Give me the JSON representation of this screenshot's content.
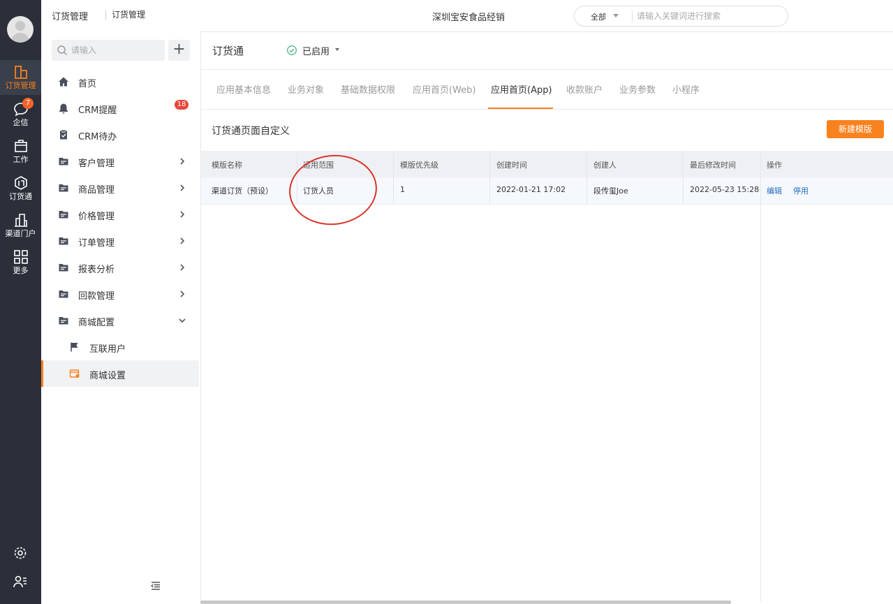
{
  "breadcrumb": {
    "module": "订货管理",
    "page": "订货管理"
  },
  "header": {
    "company": "深圳宝安食品经销",
    "search_scope": "全部",
    "search_placeholder": "请输入关键词进行搜索"
  },
  "rail": {
    "items": [
      {
        "label": "订货管理",
        "icon": "building-icon",
        "active": true
      },
      {
        "label": "企信",
        "icon": "chat-bubble-icon",
        "badge": "7"
      },
      {
        "label": "工作",
        "icon": "briefcase-icon"
      },
      {
        "label": "订货通",
        "icon": "order-app-icon"
      },
      {
        "label": "渠道门户",
        "icon": "city-icon"
      },
      {
        "label": "更多",
        "icon": "grid-icon"
      }
    ],
    "bottom": [
      "settings-icon",
      "user-list-icon"
    ]
  },
  "sidebar": {
    "search_placeholder": "请输入",
    "add_label": "+",
    "items": [
      {
        "label": "首页",
        "icon": "home-icon"
      },
      {
        "label": "CRM提醒",
        "icon": "bell-icon",
        "badge": "18"
      },
      {
        "label": "CRM待办",
        "icon": "clipboard-check-icon"
      },
      {
        "label": "客户管理",
        "icon": "folder-icon"
      },
      {
        "label": "商品管理",
        "icon": "folder-icon"
      },
      {
        "label": "价格管理",
        "icon": "folder-icon"
      },
      {
        "label": "订单管理",
        "icon": "folder-icon"
      },
      {
        "label": "报表分析",
        "icon": "folder-icon"
      },
      {
        "label": "回款管理",
        "icon": "folder-icon"
      },
      {
        "label": "商城配置",
        "icon": "folder-icon",
        "expanded": true
      }
    ],
    "sub_items": [
      {
        "label": "互联用户",
        "icon": "flag-icon"
      },
      {
        "label": "商城设置",
        "icon": "shop-settings-icon",
        "active": true
      }
    ]
  },
  "app": {
    "title": "订货通",
    "status": "已启用"
  },
  "tabs": [
    "应用基本信息",
    "业务对象",
    "基础数据权限",
    "应用首页(Web)",
    "应用首页(App)",
    "收款账户",
    "业务参数",
    "小程序"
  ],
  "active_tab": "应用首页(App)",
  "section": {
    "title": "订货通页面自定义",
    "new_button": "新建模版"
  },
  "table": {
    "headers": [
      "模版名称",
      "适用范围",
      "模版优先级",
      "创建时间",
      "创建人",
      "最后修改时间",
      "操作"
    ],
    "rows": [
      {
        "name": "渠道订货（预设）",
        "scope": "订货人员",
        "priority": "1",
        "created": "2022-01-21 17:02",
        "creator": "段传玺Joe",
        "modified": "2022-05-23 15:28",
        "actions": [
          "编辑",
          "停用"
        ]
      }
    ]
  },
  "colors": {
    "accent": "#f8821e",
    "rail": "#2b2f3a",
    "link": "#2a6ebf",
    "badge": "#e8453c",
    "annotation": "#d9342b"
  }
}
